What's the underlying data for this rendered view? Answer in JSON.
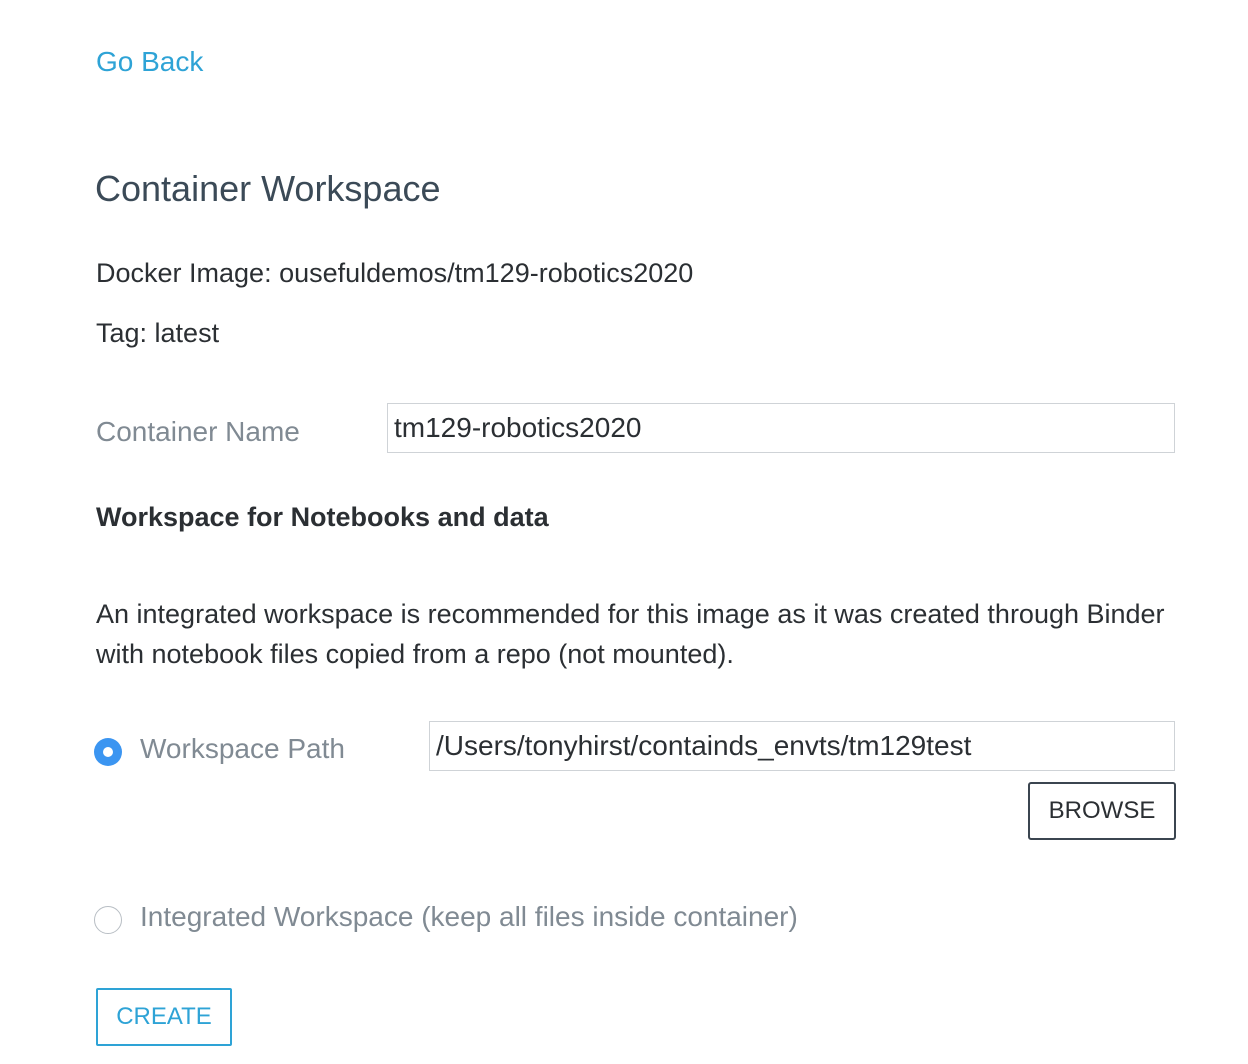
{
  "nav": {
    "go_back": "Go Back"
  },
  "page": {
    "title": "Container Workspace"
  },
  "image_info": {
    "docker_image": "Docker Image: ousefuldemos/tm129-robotics2020",
    "tag": "Tag: latest"
  },
  "container_name": {
    "label": "Container Name",
    "value": "tm129-robotics2020"
  },
  "workspace": {
    "heading": "Workspace for Notebooks and data",
    "description": "An integrated workspace is recommended for this image as it was created through Binder with notebook files copied from a repo (not mounted).",
    "path_option": {
      "label": "Workspace Path",
      "value": "/Users/tonyhirst/containds_envts/tm129test",
      "checked": true
    },
    "browse_label": "BROWSE",
    "integrated_option": {
      "label": "Integrated Workspace (keep all files inside container)",
      "checked": false
    }
  },
  "actions": {
    "create_label": "CREATE"
  },
  "colors": {
    "link": "#2ea3d6",
    "radio_selected": "#3b95f1",
    "label_gray": "#808a93",
    "text": "#2b2f33"
  }
}
